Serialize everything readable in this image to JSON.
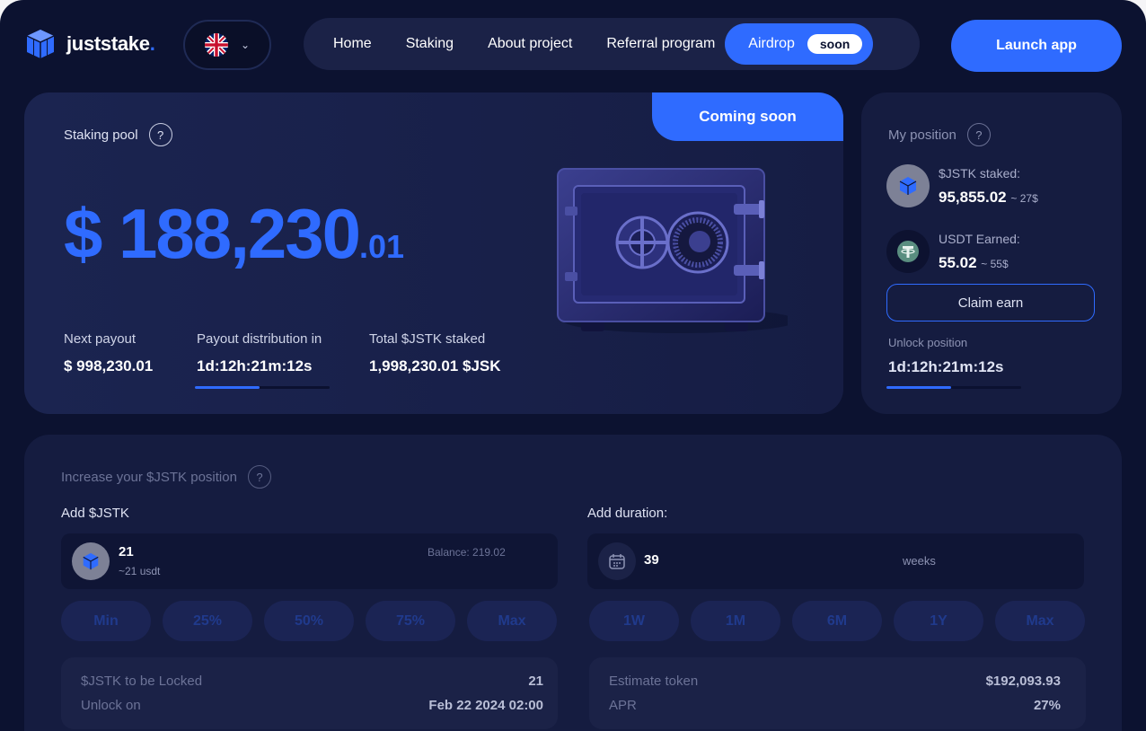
{
  "header": {
    "logo_text": "juststake",
    "logo_dot": ".",
    "language_icon": "uk-flag-icon",
    "nav": [
      "Home",
      "Staking",
      "About project",
      "Referral program"
    ],
    "airdrop_label": "Airdrop",
    "airdrop_badge": "soon",
    "launch_label": "Launch app"
  },
  "pool": {
    "title": "Staking pool",
    "help": "?",
    "badge": "Coming soon",
    "amount_main": "$ 188,230",
    "amount_cents": ".01",
    "stats": [
      {
        "label": "Next payout",
        "value": "$ 998,230.01"
      },
      {
        "label": "Payout distribution in",
        "value": "1d:12h:21m:12s"
      },
      {
        "label": "Total $JSTK staked",
        "value": "1,998,230.01 $JSK"
      }
    ],
    "payout_progress_fraction": 0.48
  },
  "position": {
    "title": "My position",
    "help": "?",
    "staked_label": "$JSTK staked:",
    "staked_value": "95,855.02",
    "staked_sub": "~ 27$",
    "earned_label": "USDT Earned:",
    "earned_value": "55.02",
    "earned_sub": "~ 55$",
    "claim_label": "Claim earn",
    "unlock_label": "Unlock position",
    "unlock_value": "1d:12h:21m:12s",
    "unlock_progress_fraction": 0.48
  },
  "increase": {
    "title": "Increase your $JSTK position",
    "help": "?",
    "add_label": "Add $JSTK",
    "amount": "21",
    "amount_usd": "~21 usdt",
    "balance": "Balance: 219.02",
    "amount_chips": [
      "Min",
      "25%",
      "50%",
      "75%",
      "Max"
    ],
    "duration_label": "Add duration:",
    "duration_value": "39",
    "duration_unit": "weeks",
    "duration_chips": [
      "1W",
      "1M",
      "6M",
      "1Y",
      "Max"
    ],
    "locked_label": "$JSTK to be Locked",
    "locked_value": "21",
    "unlock_on_label": "Unlock on",
    "unlock_on_value": "Feb 22 2024 02:00",
    "estimate_label": "Estimate token",
    "estimate_value": "$192,093.93",
    "apr_label": "APR",
    "apr_value": "27%"
  },
  "colors": {
    "background": "#0c1230",
    "accent": "#2f6bff",
    "card": "#151c40"
  }
}
